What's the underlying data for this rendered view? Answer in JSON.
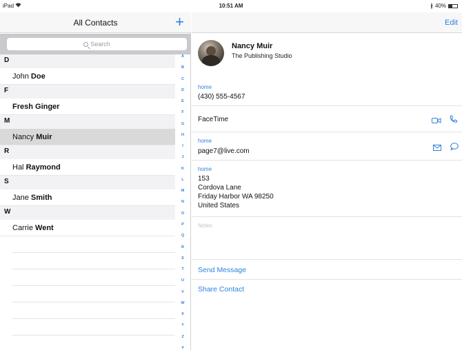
{
  "status_bar": {
    "device": "iPad",
    "time": "10:51 AM",
    "battery": "40%"
  },
  "sidebar": {
    "title": "All Contacts",
    "add_label": "+",
    "search_placeholder": "Search",
    "sections": [
      {
        "letter": "D",
        "contacts": [
          {
            "first": "John",
            "last": "Doe"
          }
        ]
      },
      {
        "letter": "F",
        "contacts": [
          {
            "first": "",
            "last": "Fresh Ginger"
          }
        ]
      },
      {
        "letter": "M",
        "contacts": [
          {
            "first": "Nancy",
            "last": "Muir",
            "selected": true
          }
        ]
      },
      {
        "letter": "R",
        "contacts": [
          {
            "first": "Hal",
            "last": "Raymond"
          }
        ]
      },
      {
        "letter": "S",
        "contacts": [
          {
            "first": "Jane",
            "last": "Smith"
          }
        ]
      },
      {
        "letter": "W",
        "contacts": [
          {
            "first": "Carrie",
            "last": "Went"
          }
        ]
      }
    ],
    "index_letters": [
      "A",
      "B",
      "C",
      "D",
      "E",
      "F",
      "G",
      "H",
      "I",
      "J",
      "K",
      "L",
      "M",
      "N",
      "O",
      "P",
      "Q",
      "R",
      "S",
      "T",
      "U",
      "V",
      "W",
      "X",
      "Y",
      "Z",
      "#"
    ]
  },
  "detail": {
    "edit_label": "Edit",
    "name": "Nancy Muir",
    "company": "The Publishing Studio",
    "phone": {
      "label": "home",
      "value": "(430) 555-4567"
    },
    "facetime": {
      "label": "FaceTime"
    },
    "email": {
      "label": "home",
      "value": "page7@live.com"
    },
    "address": {
      "label": "home",
      "lines": [
        "153",
        "Cordova Lane",
        "Friday Harbor WA 98250",
        "United States"
      ]
    },
    "notes_label": "Notes",
    "actions": {
      "send_message": "Send Message",
      "share_contact": "Share Contact"
    }
  },
  "colors": {
    "accent": "#2f7fe0",
    "selected_row": "#d9d9d9",
    "section_bg": "#f2f2f4"
  }
}
